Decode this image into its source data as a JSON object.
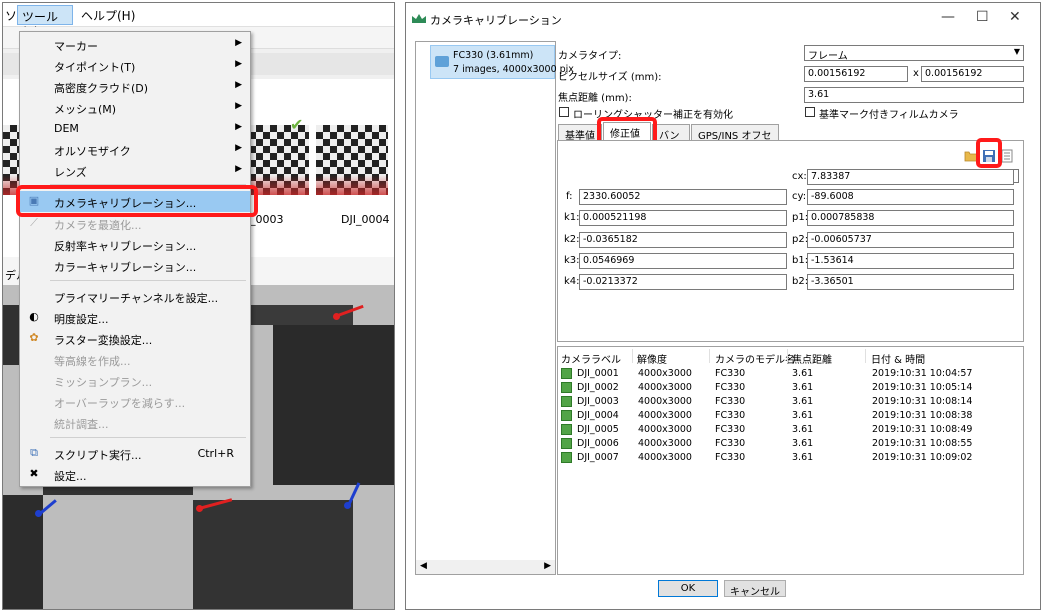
{
  "menubar": {
    "prev_fragment": "ソ",
    "tools": "ツール(T)",
    "help": "ヘルプ(H)"
  },
  "left_view": {
    "strip_fragment": "デル",
    "thumb3_label": "_0003",
    "thumb4_label": "DJI_0004"
  },
  "tools_menu": {
    "items": [
      {
        "label": "マーカー",
        "submenu": true
      },
      {
        "label": "タイポイント(T)",
        "submenu": true
      },
      {
        "label": "高密度クラウド(D)",
        "submenu": true
      },
      {
        "label": "メッシュ(M)",
        "submenu": true
      },
      {
        "label": "DEM",
        "submenu": true
      },
      {
        "label": "オルソモザイク",
        "submenu": true
      },
      {
        "label": "レンズ",
        "submenu": true
      },
      {
        "label": "カメラキャリブレーション...",
        "highlighted": true
      },
      {
        "label": "カメラを最適化...",
        "disabled": true
      },
      {
        "label": "反射率キャリブレーション..."
      },
      {
        "label": "カラーキャリブレーション..."
      },
      {
        "label": "プライマリーチャンネルを設定..."
      },
      {
        "label": "明度設定..."
      },
      {
        "label": "ラスター変換設定..."
      },
      {
        "label": "等高線を作成...",
        "disabled": true
      },
      {
        "label": "ミッションプラン...",
        "disabled": true
      },
      {
        "label": "オーバーラップを減らす...",
        "disabled": true
      },
      {
        "label": "統計調査...",
        "disabled": true
      },
      {
        "label": "スクリプト実行...",
        "shortcut": "Ctrl+R"
      },
      {
        "label": "設定..."
      }
    ]
  },
  "dialog": {
    "title": "カメラキャリブレーション",
    "camera_list": {
      "name": "FC330 (3.61mm)",
      "sub": "7 images, 4000x3000 pix"
    },
    "camera_type_label": "カメラタイプ:",
    "camera_type_value": "フレーム",
    "pixel_size_label": "ピクセルサイズ (mm):",
    "pixel_size_x": "0.00156192",
    "pixel_size_sep": "x",
    "pixel_size_y": "0.00156192",
    "focal_label": "焦点距離 (mm):",
    "focal_value": "3.61",
    "rolling_shutter_label": "ローリングシャッター補正を有効化",
    "fiducial_label": "基準マーク付きフィルムカメラ",
    "tabs": [
      "基準値",
      "修正値",
      "バンド",
      "GPS/INS オフセット"
    ],
    "tooltip": "保存",
    "params": {
      "cx_label": "cx:",
      "cx": "7.83387",
      "f_label": "f:",
      "f": "2330.60052",
      "cy_label": "cy:",
      "cy": "-89.6008",
      "k1_label": "k1:",
      "k1": "0.000521198",
      "p1_label": "p1:",
      "p1": "0.000785838",
      "k2_label": "k2:",
      "k2": "-0.0365182",
      "p2_label": "p2:",
      "p2": "-0.00605737",
      "k3_label": "k3:",
      "k3": "0.0546969",
      "b1_label": "b1:",
      "b1": "-1.53614",
      "k4_label": "k4:",
      "k4": "-0.0213372",
      "b2_label": "b2:",
      "b2": "-3.36501"
    },
    "table": {
      "headers": [
        "カメララベル",
        "解像度",
        "カメラのモデル名",
        "焦点距離",
        "日付 & 時間"
      ],
      "rows": [
        [
          "DJI_0001",
          "4000x3000",
          "FC330",
          "3.61",
          "2019:10:31 10:04:57"
        ],
        [
          "DJI_0002",
          "4000x3000",
          "FC330",
          "3.61",
          "2019:10:31 10:05:14"
        ],
        [
          "DJI_0003",
          "4000x3000",
          "FC330",
          "3.61",
          "2019:10:31 10:08:14"
        ],
        [
          "DJI_0004",
          "4000x3000",
          "FC330",
          "3.61",
          "2019:10:31 10:08:38"
        ],
        [
          "DJI_0005",
          "4000x3000",
          "FC330",
          "3.61",
          "2019:10:31 10:08:49"
        ],
        [
          "DJI_0006",
          "4000x3000",
          "FC330",
          "3.61",
          "2019:10:31 10:08:55"
        ],
        [
          "DJI_0007",
          "4000x3000",
          "FC330",
          "3.61",
          "2019:10:31 10:09:02"
        ]
      ]
    },
    "ok_label": "OK",
    "cancel_label": "キャンセル"
  },
  "colors": {
    "highlight_red": "#ff1a1a",
    "menu_highlight": "#99c9f2",
    "selection": "#cce4f7"
  }
}
